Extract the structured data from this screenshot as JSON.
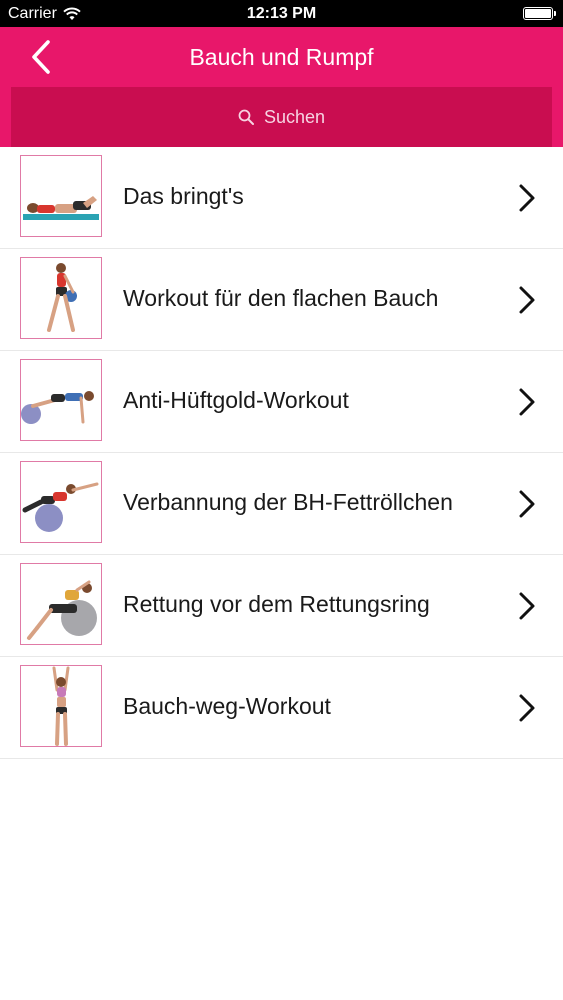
{
  "status_bar": {
    "carrier": "Carrier",
    "time": "12:13 PM",
    "icons": [
      "wifi-icon",
      "battery-icon"
    ]
  },
  "nav": {
    "title": "Bauch und Rumpf",
    "back_icon": "chevron-left-icon"
  },
  "search": {
    "placeholder": "Suchen",
    "icon": "search-icon"
  },
  "colors": {
    "accent": "#e8176a",
    "search_field": "#c90d50",
    "thumb_border": "#e07aa6"
  },
  "list": {
    "items": [
      {
        "label": "Das bringt's",
        "thumbnail": "exercise-photo"
      },
      {
        "label": "Workout für den flachen Bauch",
        "thumbnail": "exercise-photo"
      },
      {
        "label": "Anti-Hüftgold-Workout",
        "thumbnail": "exercise-photo"
      },
      {
        "label": "Verbannung der BH-Fettröllchen",
        "thumbnail": "exercise-photo"
      },
      {
        "label": "Rettung vor dem Rettungsring",
        "thumbnail": "exercise-photo"
      },
      {
        "label": "Bauch-weg-Workout",
        "thumbnail": "exercise-photo"
      }
    ],
    "row_icon": "chevron-right-icon"
  }
}
